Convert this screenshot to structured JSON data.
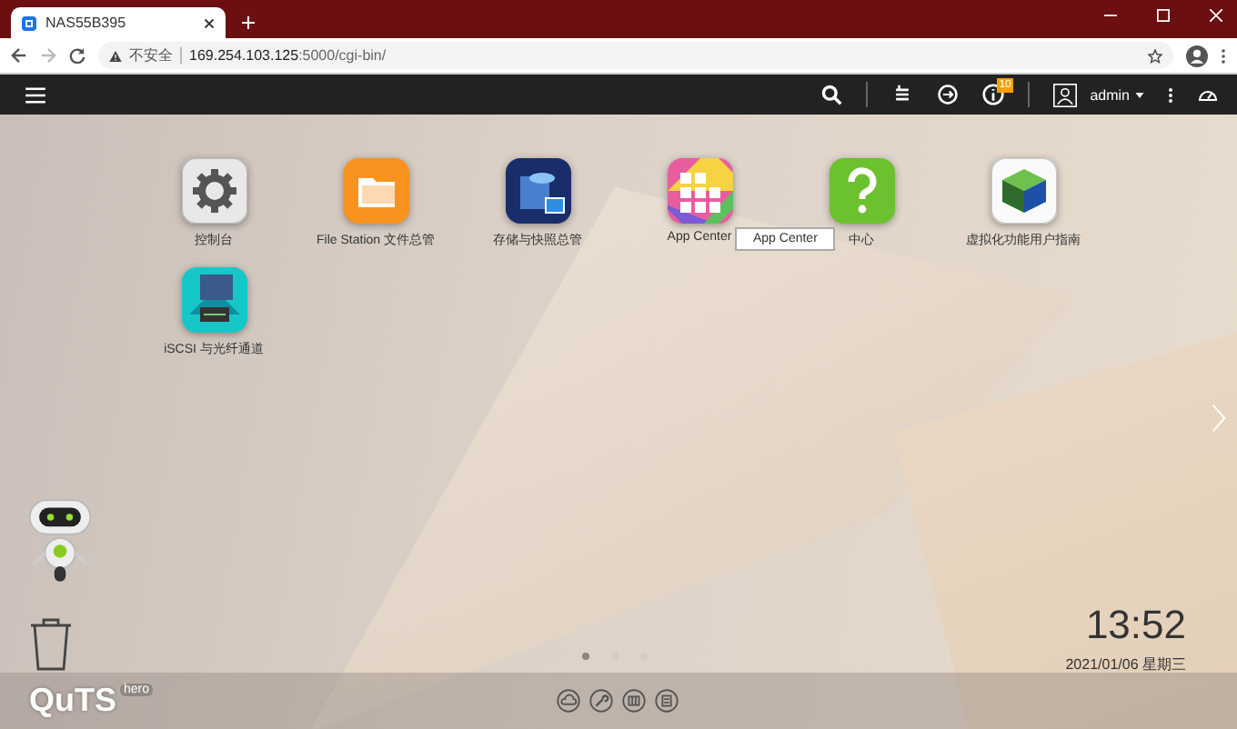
{
  "browser": {
    "tab_title": "NAS55B395",
    "security": "不安全",
    "url_host": "169.254.103.125",
    "url_path": ":5000/cgi-bin/"
  },
  "toolbar": {
    "user": "admin",
    "notification_count": "10"
  },
  "apps": [
    {
      "kind": "gear",
      "label": "控制台"
    },
    {
      "kind": "folder",
      "label": "File Station 文件总管"
    },
    {
      "kind": "storage",
      "label": "存储与快照总管"
    },
    {
      "kind": "appcenter",
      "label": "App Center"
    },
    {
      "kind": "help",
      "label": "中心"
    },
    {
      "kind": "cube",
      "label": "虚拟化功能用户指南"
    },
    {
      "kind": "iscsi",
      "label": "iSCSI 与光纤通道"
    }
  ],
  "tooltip": "App Center",
  "clock": {
    "time": "13:52",
    "date": "2021/01/06 星期三"
  },
  "pages": [
    {
      "selected": true
    },
    {
      "selected": false
    },
    {
      "selected": false
    }
  ],
  "logo": {
    "name": "QuTS",
    "suffix": "hero"
  }
}
